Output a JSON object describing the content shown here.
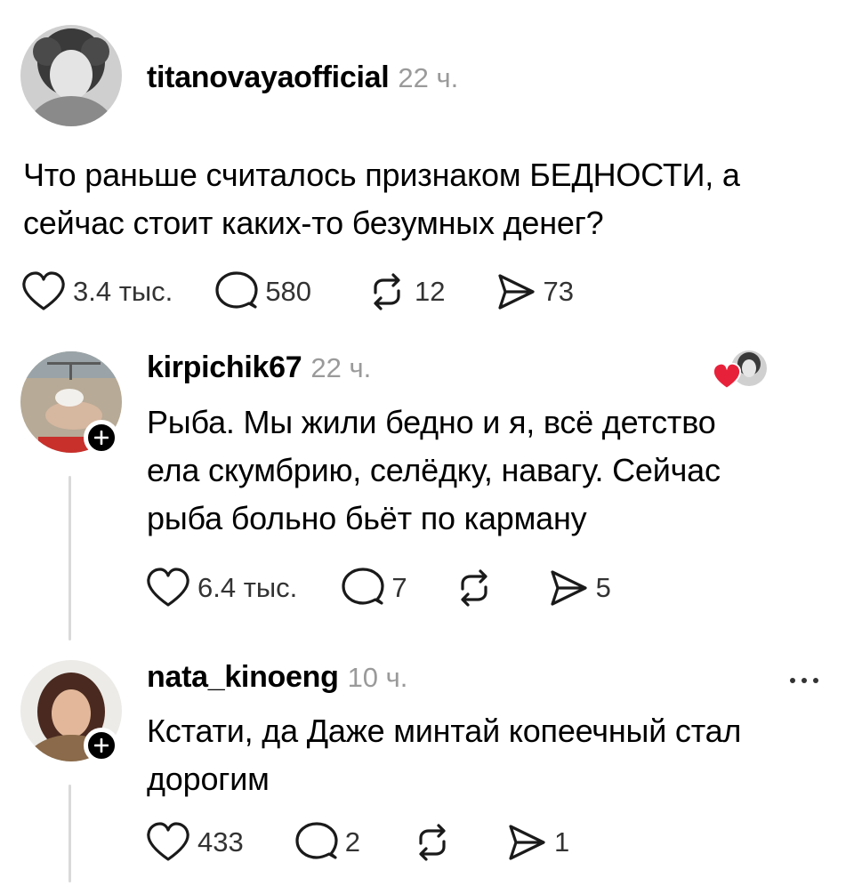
{
  "post": {
    "username": "titanovayaofficial",
    "time": "22 ч.",
    "text_line1": "Что раньше считалось признаком БЕДНОСТИ, а",
    "text_line2": "сейчас стоит каких-то безумных денег?",
    "likes": "3.4 тыс.",
    "comments": "580",
    "reposts": "12",
    "shares": "73"
  },
  "replies": [
    {
      "username": "kirpichik67",
      "time": "22 ч.",
      "lines": [
        "Рыба. Мы жили бедно и я, всё детство",
        "ела скумбрию, селёдку, навагу. Сейчас",
        "рыба больно бьёт по карману"
      ],
      "likes": "6.4 тыс.",
      "comments": "7",
      "reposts": "",
      "shares": "5"
    },
    {
      "username": "nata_kinoeng",
      "time": "10 ч.",
      "lines": [
        "Кстати, да Даже минтай копеечный стал",
        "дорогим"
      ],
      "likes": "433",
      "comments": "2",
      "reposts": "",
      "shares": "1"
    }
  ],
  "icons": {
    "like": "heart-icon",
    "comment": "comment-bubble-icon",
    "repost": "repost-icon",
    "share": "send-icon",
    "follow": "plus-icon",
    "liked_by_author": "heart-badge-icon",
    "more": "more-icon"
  },
  "colors": {
    "heart_badge": "#e8213a",
    "muted_text": "#9a9a9a",
    "thread_line": "#d9d9d9"
  }
}
